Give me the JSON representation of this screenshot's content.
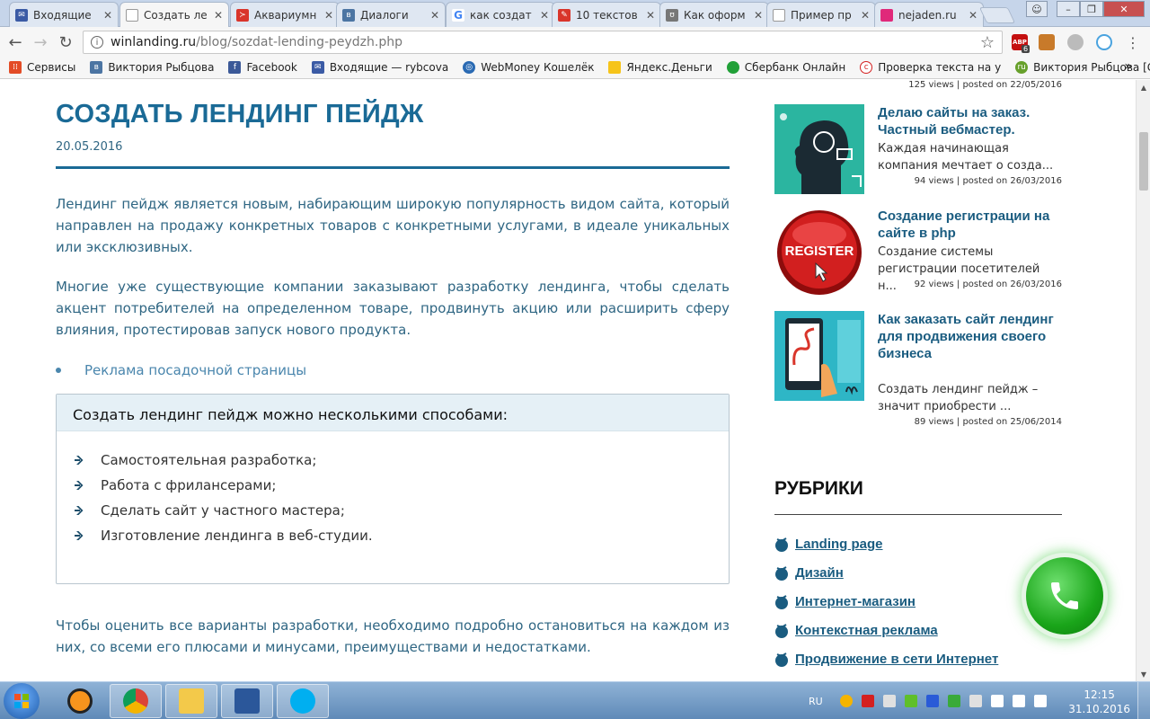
{
  "browser": {
    "tabs": [
      {
        "title": "Входящие",
        "color": "#3b5ba5"
      },
      {
        "title": "Создать ле",
        "color": "#999999"
      },
      {
        "title": "Аквариумн",
        "color": "#d9352b"
      },
      {
        "title": "Диалоги",
        "color": "#4c75a3"
      },
      {
        "title": "как создат",
        "color": "#4285f4"
      },
      {
        "title": "10 текстов",
        "color": "#d9352b"
      },
      {
        "title": "Как оформ",
        "color": "#777777"
      },
      {
        "title": "Пример пр",
        "color": "#999999"
      },
      {
        "title": "nejaden.ru",
        "color": "#e0297a"
      }
    ],
    "url_domain": "winlanding.ru",
    "url_path": "/blog/sozdat-lending-peydzh.php",
    "ext_badge": "ABP",
    "ext_count": "6",
    "bookmarks": [
      {
        "label": "Сервисы",
        "color": "#e34c26"
      },
      {
        "label": "Виктория Рыбцова",
        "color": "#4c75a3"
      },
      {
        "label": "Facebook",
        "color": "#3b5998"
      },
      {
        "label": "Входящие — rybcova",
        "color": "#3b5ba5"
      },
      {
        "label": "WebMoney Кошелёк",
        "color": "#2a6ab3"
      },
      {
        "label": "Яндекс.Деньги",
        "color": "#f6c41a"
      },
      {
        "label": "Сбербанк Онлайн",
        "color": "#21a038"
      },
      {
        "label": "Проверка текста на у",
        "color": "#d42020"
      },
      {
        "label": "Виктория Рыбцова [G",
        "color": "#67a02b"
      }
    ],
    "bookmark_ru_glyph": "ru",
    "bookmarks_more": "»"
  },
  "article": {
    "title": "СОЗДАТЬ ЛЕНДИНГ ПЕЙДЖ",
    "date": "20.05.2016",
    "para1": "Лендинг пейдж является новым, набирающим широкую популярность видом сайта, который направлен на продажу конкретных товаров с конкретными услугами, в идеале уникальных или эксклюзивных.",
    "para2": "Многие уже существующие компании заказывают разработку лендинга, чтобы сделать акцент потребителей на определенном товаре, продвинуть акцию или расширить сферу влияния, протестировав запуск нового продукта.",
    "bullet_link": "Реклама посадочной страницы",
    "box_heading": "Создать лендинг пейдж можно несколькими способами:",
    "ways": [
      "Самостоятельная разработка;",
      "Работа с фрилансерами;",
      "Сделать сайт у частного мастера;",
      "Изготовление лендинга в веб-студии."
    ],
    "para3": "Чтобы оценить все варианты разработки, необходимо подробно остановиться на каждом из них, со всеми его плюсами и минусами, преимуществами и недостатками."
  },
  "sidebar": {
    "top_meta": "125 views | posted on 22/05/2016",
    "posts": [
      {
        "title": "Делаю сайты на заказ. Частный вебмастер.",
        "excerpt": "Каждая начинающая компания мечтает о созда...",
        "meta": "94 views | posted on 26/03/2016"
      },
      {
        "title": "Создание регистрации на сайте в php",
        "excerpt": "Создание системы регистрации посетителей н...",
        "meta": "92 views | posted on 26/03/2016",
        "badge": "REGISTER"
      },
      {
        "title": "Как заказать сайт лендинг для продвижения своего бизнеса",
        "excerpt": "Создать лендинг пейдж – значит приобрести ...",
        "meta": "89 views | posted on 25/06/2014"
      }
    ],
    "rubrics_title": "РУБРИКИ",
    "rubrics": [
      "Landing page",
      "Дизайн",
      "Интернет-магазин",
      "Контекстная реклама",
      "Продвижение в сети Интернет"
    ]
  },
  "taskbar": {
    "lang": "RU",
    "time": "12:15",
    "date": "31.10.2016"
  }
}
